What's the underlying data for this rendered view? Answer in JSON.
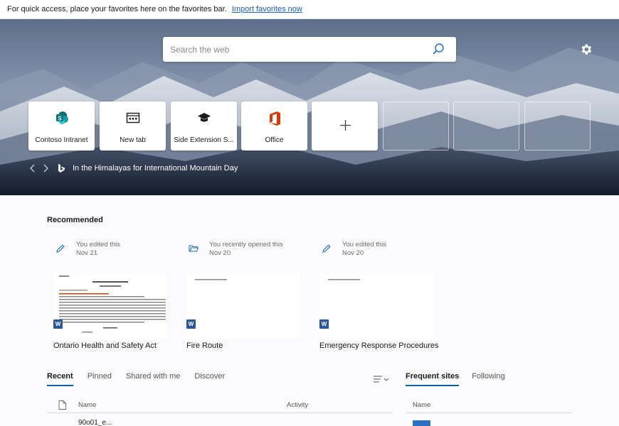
{
  "favorites_bar": {
    "message": "For quick access, place your favorites here on the favorites bar.",
    "import_link": "Import favorites now"
  },
  "search": {
    "placeholder": "Search the web",
    "icon": "search-icon"
  },
  "settings": {
    "icon": "gear-icon"
  },
  "quick_links": [
    {
      "label": "Contoso Intranet",
      "icon": "sharepoint-icon"
    },
    {
      "label": "New tab",
      "icon": "new-tab-icon"
    },
    {
      "label": "Side Extension S...",
      "icon": "graduation-cap-icon"
    },
    {
      "label": "Office",
      "icon": "office-icon"
    },
    {
      "label": "",
      "icon": "plus-icon"
    }
  ],
  "background_caption": {
    "text": "In the Himalayas for International Mountain Day"
  },
  "recommended": {
    "title": "Recommended",
    "items": [
      {
        "activity": "You edited this",
        "date": "Nov 21",
        "name": "Ontario Health and Safety Act",
        "icon": "pencil-icon"
      },
      {
        "activity": "You recently opened this",
        "date": "Nov 20",
        "name": "Fire Route",
        "icon": "folder-open-icon"
      },
      {
        "activity": "You edited this",
        "date": "Nov 20",
        "name": "Emergency Response Procedures",
        "icon": "pencil-icon"
      }
    ]
  },
  "doc_tabs": [
    "Recent",
    "Pinned",
    "Shared with me",
    "Discover"
  ],
  "site_tabs": [
    "Frequent sites",
    "Following"
  ],
  "files_table": {
    "col_name": "Name",
    "col_activity": "Activity",
    "first_row": "90o01_e..."
  },
  "sites_table": {
    "col_name": "Name"
  },
  "colors": {
    "accent": "#0b5fa5",
    "word_blue": "#2b579a",
    "office_orange": "#d83b01"
  }
}
